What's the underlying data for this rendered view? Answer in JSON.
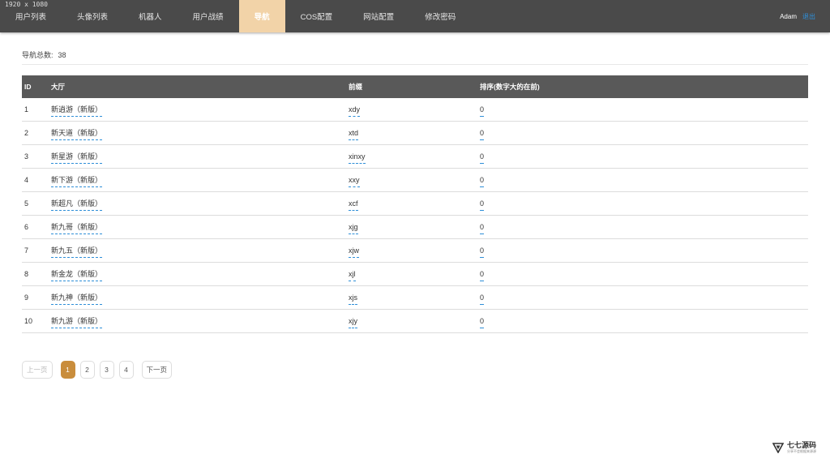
{
  "screen_label": "1920 x 1080",
  "nav": {
    "items": [
      {
        "label": "用户列表",
        "active": false
      },
      {
        "label": "头像列表",
        "active": false
      },
      {
        "label": "机器人",
        "active": false
      },
      {
        "label": "用户战绩",
        "active": false
      },
      {
        "label": "导航",
        "active": true
      },
      {
        "label": "COS配置",
        "active": false
      },
      {
        "label": "网站配置",
        "active": false
      },
      {
        "label": "修改密码",
        "active": false
      }
    ]
  },
  "user": {
    "name": "Adam",
    "logout_label": "退出"
  },
  "summary": {
    "label": "导航总数:",
    "count": "38"
  },
  "table": {
    "headers": {
      "id": "ID",
      "hall": "大厅",
      "prefix": "前缀",
      "sort": "排序(数字大的在前)"
    },
    "rows": [
      {
        "id": "1",
        "hall": "新逍游（新版）",
        "prefix": "xdy",
        "sort": "0"
      },
      {
        "id": "2",
        "hall": "新天道（新版）",
        "prefix": "xtd",
        "sort": "0"
      },
      {
        "id": "3",
        "hall": "新星游（新版）",
        "prefix": "xinxy",
        "sort": "0"
      },
      {
        "id": "4",
        "hall": "新下游（新版）",
        "prefix": "xxy",
        "sort": "0"
      },
      {
        "id": "5",
        "hall": "新超凡（新版）",
        "prefix": "xcf",
        "sort": "0"
      },
      {
        "id": "6",
        "hall": "新九哥（新版）",
        "prefix": "xjg",
        "sort": "0"
      },
      {
        "id": "7",
        "hall": "新九五（新版）",
        "prefix": "xjw",
        "sort": "0"
      },
      {
        "id": "8",
        "hall": "新金龙（新版）",
        "prefix": "xjl",
        "sort": "0"
      },
      {
        "id": "9",
        "hall": "新九神（新版）",
        "prefix": "xjs",
        "sort": "0"
      },
      {
        "id": "10",
        "hall": "新九游（新版）",
        "prefix": "xjy",
        "sort": "0"
      }
    ]
  },
  "pagination": {
    "prev_label": "上一页",
    "next_label": "下一页",
    "pages": [
      "1",
      "2",
      "3",
      "4"
    ],
    "current": "1"
  },
  "watermark": {
    "title": "七七源码",
    "subtitle": "分享不会根据来源源"
  },
  "colors": {
    "topbar": "#4a4a4a",
    "active_nav": "#f2d3a8",
    "accent": "#c98d3c",
    "link": "#2f8fd8",
    "table_header": "#595959"
  }
}
